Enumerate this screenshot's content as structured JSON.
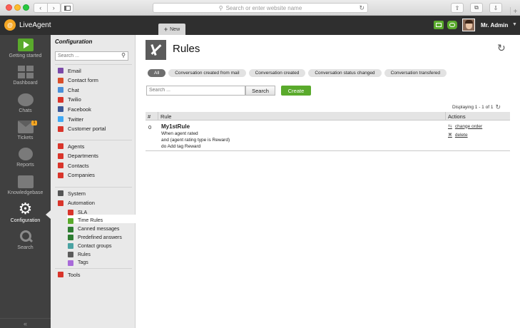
{
  "browser": {
    "url_placeholder": "Search or enter website name"
  },
  "app": {
    "brand": "LiveAgent",
    "new_tab_label": "New",
    "user_name": "Mr. Admin"
  },
  "leftnav": [
    {
      "label": "Getting started"
    },
    {
      "label": "Dashboard"
    },
    {
      "label": "Chats"
    },
    {
      "label": "Tickets",
      "badge": "1"
    },
    {
      "label": "Reports"
    },
    {
      "label": "Knowledgebase"
    },
    {
      "label": "Configuration"
    },
    {
      "label": "Search"
    }
  ],
  "config": {
    "title": "Configuration",
    "search_placeholder": "Search ...",
    "group1": [
      "Email",
      "Contact form",
      "Chat",
      "Twilio",
      "Facebook",
      "Twitter",
      "Customer portal"
    ],
    "group2": [
      "Agents",
      "Departments",
      "Contacts",
      "Companies"
    ],
    "group3": [
      "System",
      "Automation"
    ],
    "automation_sub": [
      "SLA",
      "Time Rules",
      "Canned messages",
      "Predefined answers",
      "Contact groups",
      "Rules",
      "Tags"
    ],
    "tools": "Tools",
    "colors": {
      "group1": [
        "#7b4aa8",
        "#d94f2b",
        "#4a90d9",
        "#d9352b",
        "#3b5998",
        "#3fa9f5",
        "#d9352b"
      ],
      "group2": [
        "#d9352b",
        "#d9352b",
        "#d9352b",
        "#d9352b"
      ],
      "group3": [
        "#555555",
        "#d9352b"
      ],
      "automation_sub": [
        "#d9352b",
        "#5aaa2c",
        "#2e7d32",
        "#2e7d32",
        "#4aa3a3",
        "#5b5b5b",
        "#a86ad9"
      ],
      "tools": "#d9352b"
    }
  },
  "main": {
    "title": "Rules",
    "filters": [
      {
        "label": "All",
        "active": true
      },
      {
        "label": "Conversation created from mail"
      },
      {
        "label": "Conversation created"
      },
      {
        "label": "Conversation status changed"
      },
      {
        "label": "Conversation transfered"
      }
    ],
    "search_placeholder": "Search ...",
    "search_button": "Search",
    "create_button": "Create",
    "displaying": "Displaying 1 - 1 of 1",
    "table": {
      "headers": [
        "#",
        "Rule",
        "Actions"
      ],
      "rows": [
        {
          "num": "0",
          "name": "My1stRule",
          "lines": [
            "When agent rated",
            "and (agent rating type is Reward)",
            "do Add tag Reward"
          ],
          "actions": [
            "change order",
            "delete"
          ]
        }
      ]
    }
  }
}
